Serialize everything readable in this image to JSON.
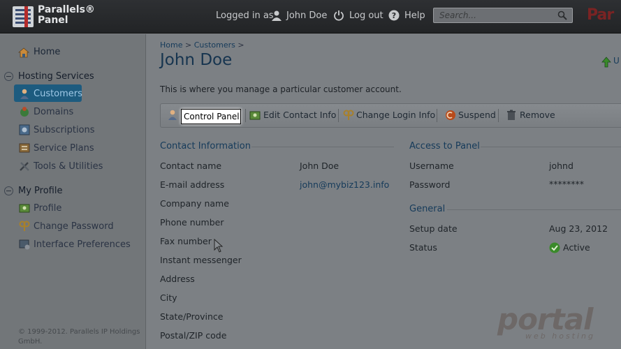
{
  "header": {
    "brand_line1": "Parallels®",
    "brand_line2": "Panel",
    "logged_in_prefix": "Logged in as",
    "user_name": "John Doe",
    "logout_label": "Log out",
    "help_label": "Help",
    "search_placeholder": "Search...",
    "partner_brand": "Par"
  },
  "sidebar": {
    "home": "Home",
    "hosting_title": "Hosting Services",
    "hosting_items": [
      "Customers",
      "Domains",
      "Subscriptions",
      "Service Plans",
      "Tools & Utilities"
    ],
    "profile_title": "My Profile",
    "profile_items": [
      "Profile",
      "Change Password",
      "Interface Preferences"
    ],
    "copyright": "© 1999-2012. Parallels IP Holdings GmbH."
  },
  "breadcrumb": {
    "home": "Home",
    "customers": "Customers",
    "sep": ">"
  },
  "page_title": "John Doe",
  "page_link": "U",
  "description": "This is where you manage a particular customer account.",
  "toolbar": {
    "control_panel": "Control Panel",
    "edit_contact": "Edit Contact Info",
    "change_login": "Change Login Info",
    "suspend": "Suspend",
    "remove": "Remove"
  },
  "contact": {
    "title": "Contact Information",
    "labels": [
      "Contact name",
      "E-mail address",
      "Company name",
      "Phone number",
      "Fax number",
      "Instant messenger",
      "Address",
      "City",
      "State/Province",
      "Postal/ZIP code"
    ],
    "contact_name": "John Doe",
    "email": "john@mybiz123.info"
  },
  "access": {
    "title": "Access to Panel",
    "username_label": "Username",
    "username": "johnd",
    "password_label": "Password",
    "password": "********"
  },
  "general": {
    "title": "General",
    "setup_label": "Setup date",
    "setup_date": "Aug 23, 2012",
    "status_label": "Status",
    "status": "Active"
  },
  "watermark": {
    "main": "portal",
    "sub": "web hosting"
  },
  "colors": {
    "accent": "#1d5b7f",
    "link": "#153a5a",
    "status_ok": "#3a8a2a"
  }
}
